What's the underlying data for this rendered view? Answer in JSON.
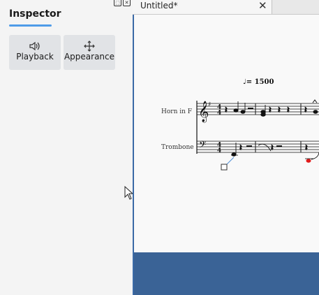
{
  "inspector": {
    "title": "Inspector",
    "buttons": [
      {
        "label": "Playback",
        "icon": "speaker-icon"
      },
      {
        "label": "Appearance",
        "icon": "move-arrows-icon"
      }
    ]
  },
  "score_tab": {
    "title": "Untitled*",
    "close_label": "✕"
  },
  "score": {
    "tempo": "= 1500",
    "instruments": [
      "Horn in F",
      "Trombone"
    ]
  }
}
